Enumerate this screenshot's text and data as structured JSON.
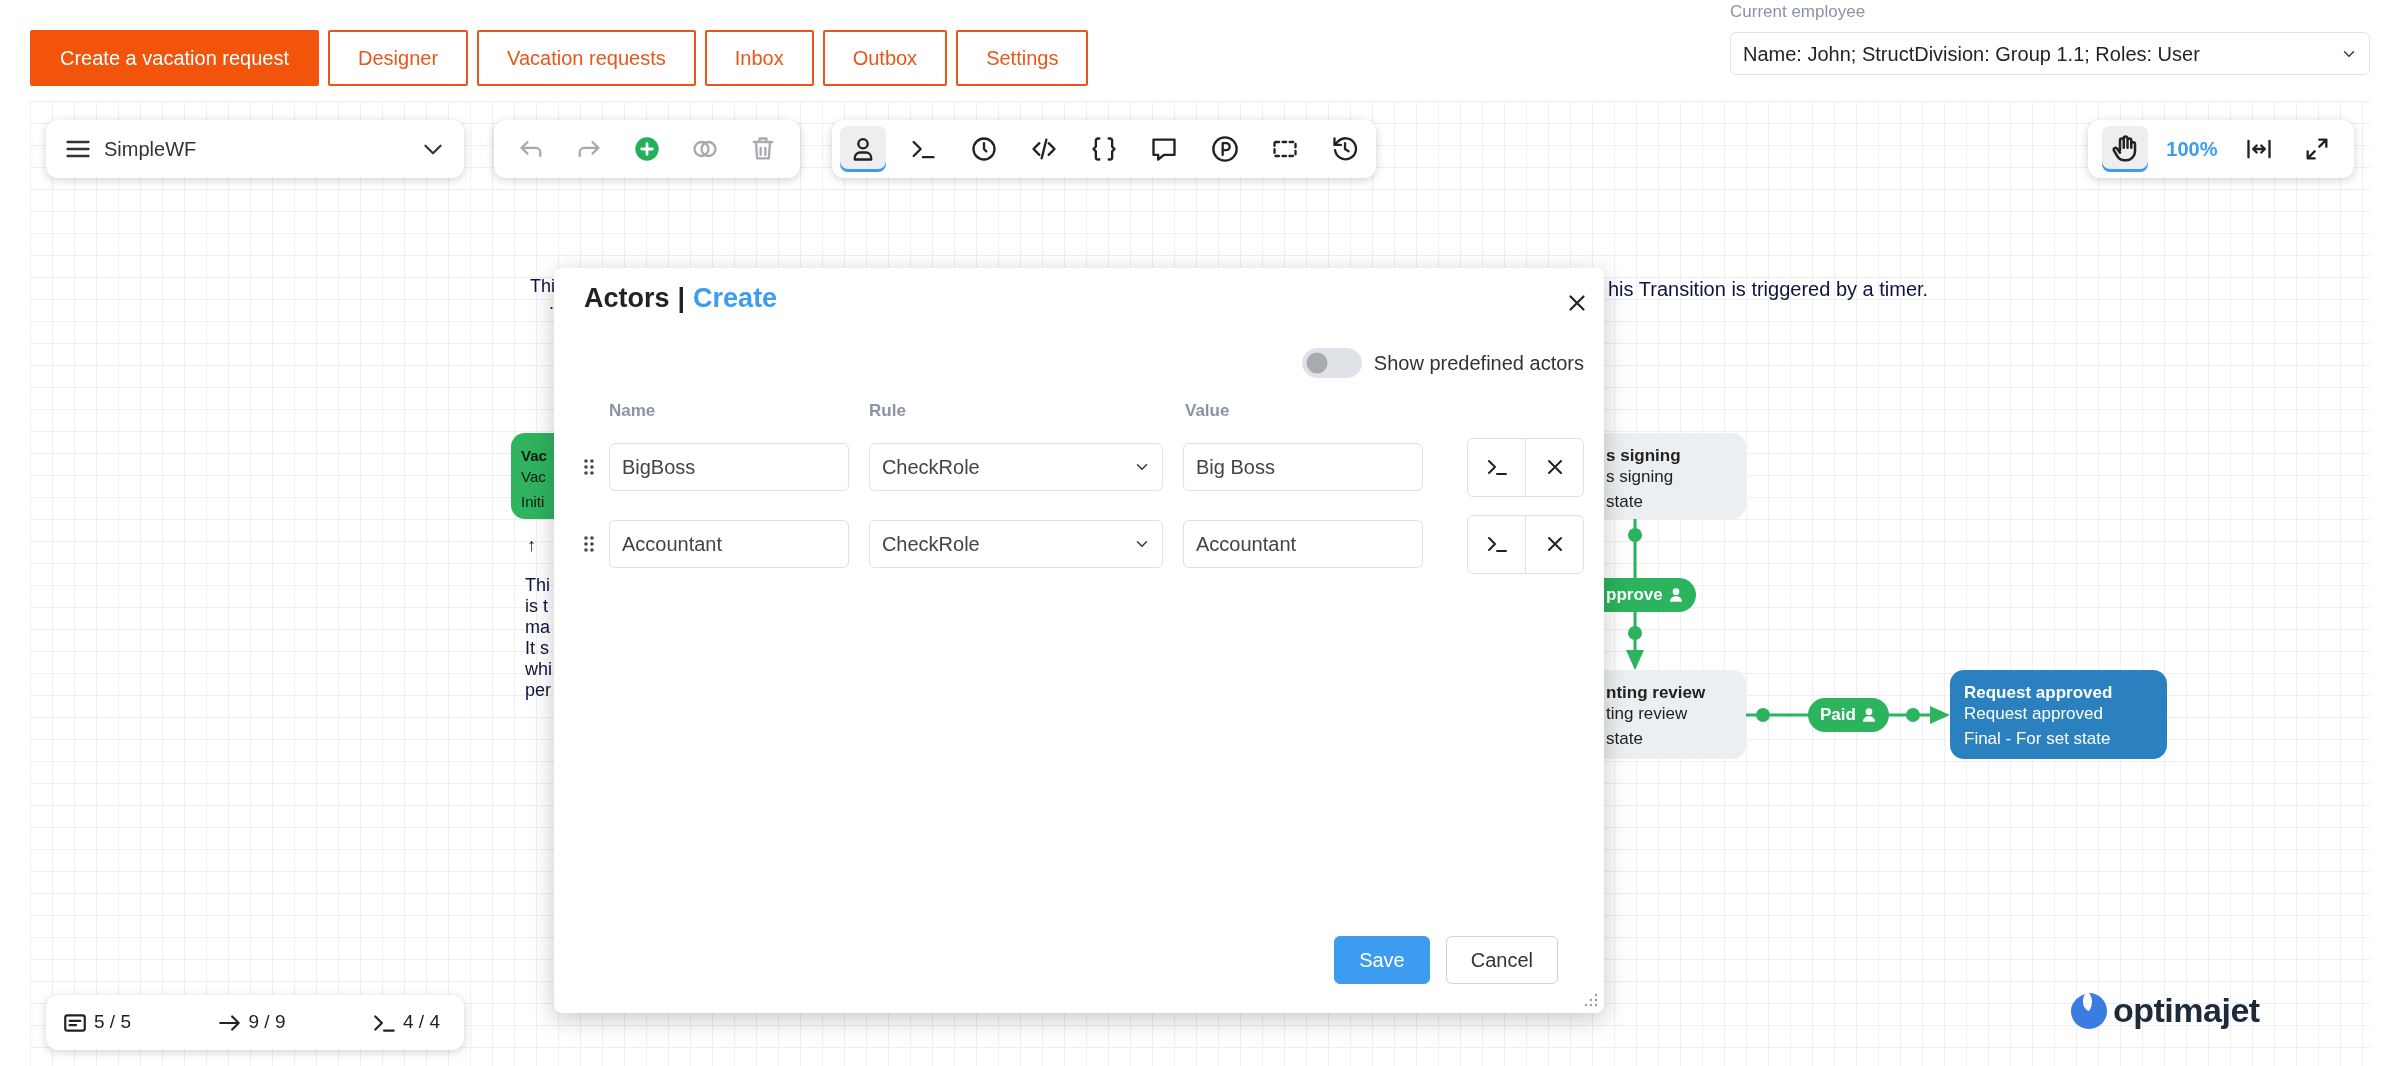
{
  "header": {
    "buttons": [
      {
        "label": "Create a vacation request",
        "kind": "primary"
      },
      {
        "label": "Designer",
        "kind": "outline"
      },
      {
        "label": "Vacation requests",
        "kind": "outline"
      },
      {
        "label": "Inbox",
        "kind": "outline"
      },
      {
        "label": "Outbox",
        "kind": "outline"
      },
      {
        "label": "Settings",
        "kind": "outline"
      }
    ],
    "employee": {
      "label": "Current employee",
      "value": "Name: John; StructDivision: Group 1.1; Roles: User"
    }
  },
  "toolbar": {
    "workflow": "SimpleWF",
    "edit_tools": [
      {
        "disabled": true
      },
      {
        "disabled": true
      },
      {
        "disabled": false
      },
      {
        "disabled": true
      },
      {
        "disabled": true
      }
    ],
    "element_tools": [
      {
        "selected": true
      },
      {
        "selected": false
      },
      {
        "selected": false
      },
      {
        "selected": false
      },
      {
        "selected": false
      },
      {
        "selected": false
      },
      {
        "selected": false
      },
      {
        "selected": false
      },
      {
        "selected": false
      }
    ],
    "view": {
      "pan_selected": true,
      "zoom": "100%"
    }
  },
  "canvas": {
    "notes": [
      {
        "text": "Thi"
      },
      {
        "text": "his Transition is triggered by a timer."
      },
      {
        "text": "."
      },
      {
        "text": "↑"
      },
      {
        "text": "Thi\nis t\nma\nIt s\nwhi\nper"
      }
    ],
    "states": [
      {
        "title": "Vac",
        "name": "Vac",
        "type_label": "Initi",
        "kind": "initial"
      },
      {
        "title": "s signing",
        "name": "s signing",
        "type_label": "state",
        "kind": "normal"
      },
      {
        "title": "nting review",
        "name": "ting review",
        "type_label": "state",
        "kind": "normal"
      },
      {
        "title": "Request approved",
        "name": "Request approved",
        "type_label": "Final - For set state",
        "kind": "final"
      }
    ],
    "transitions": [
      {
        "label": "pprove"
      },
      {
        "label": "Paid"
      }
    ]
  },
  "dialog": {
    "title": "Actors",
    "separator": "|",
    "mode": "Create",
    "toggle": {
      "label": "Show predefined actors",
      "on": false
    },
    "columns": [
      "Name",
      "Rule",
      "Value"
    ],
    "rows": [
      {
        "name": "BigBoss",
        "rule": "CheckRole",
        "value": "Big Boss"
      },
      {
        "name": "Accountant",
        "rule": "CheckRole",
        "value": "Accountant"
      }
    ],
    "buttons": [
      {
        "label": "Save",
        "kind": "primary"
      },
      {
        "label": "Cancel",
        "kind": "secondary"
      }
    ]
  },
  "counters": [
    {
      "text": "5 / 5"
    },
    {
      "text": "9 / 9"
    },
    {
      "text": "4 / 4"
    }
  ],
  "logo": "optimajet"
}
